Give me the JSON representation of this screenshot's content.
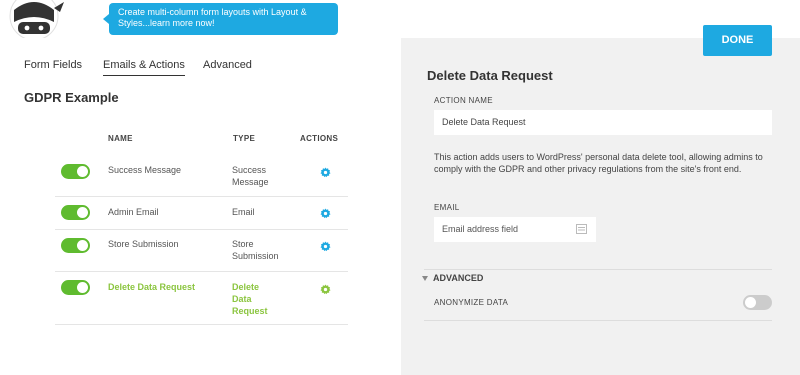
{
  "tip": {
    "text": "Create multi-column form layouts with Layout & Styles...learn more now!"
  },
  "tabs": [
    {
      "label": "Form Fields"
    },
    {
      "label": "Emails & Actions"
    },
    {
      "label": "Advanced"
    }
  ],
  "form_title": "GDPR Example",
  "table": {
    "headers": {
      "name": "NAME",
      "type": "TYPE",
      "actions": "ACTIONS"
    },
    "rows": [
      {
        "name": "Success Message",
        "type": "Success Message",
        "enabled": true
      },
      {
        "name": "Admin Email",
        "type": "Email",
        "enabled": true
      },
      {
        "name": "Store Submission",
        "type": "Store Submission",
        "enabled": true
      },
      {
        "name": "Delete Data Request",
        "type": "Delete Data Request",
        "enabled": true,
        "active": true
      }
    ]
  },
  "panel": {
    "done_label": "DONE",
    "title": "Delete Data Request",
    "action_name_label": "ACTION NAME",
    "action_name_value": "Delete Data Request",
    "description": "This action adds users to WordPress' personal data delete tool, allowing admins to comply with the GDPR and other privacy regulations from the site's front end.",
    "email_label": "EMAIL",
    "email_placeholder": "Email address field",
    "advanced_label": "ADVANCED",
    "anonymize_label": "ANONYMIZE DATA",
    "anonymize_on": false
  },
  "colors": {
    "accent": "#1ea9e1",
    "toggle_on": "#5fbb2f",
    "active_text": "#8bc53f",
    "panel_bg": "#f1f1f1"
  }
}
